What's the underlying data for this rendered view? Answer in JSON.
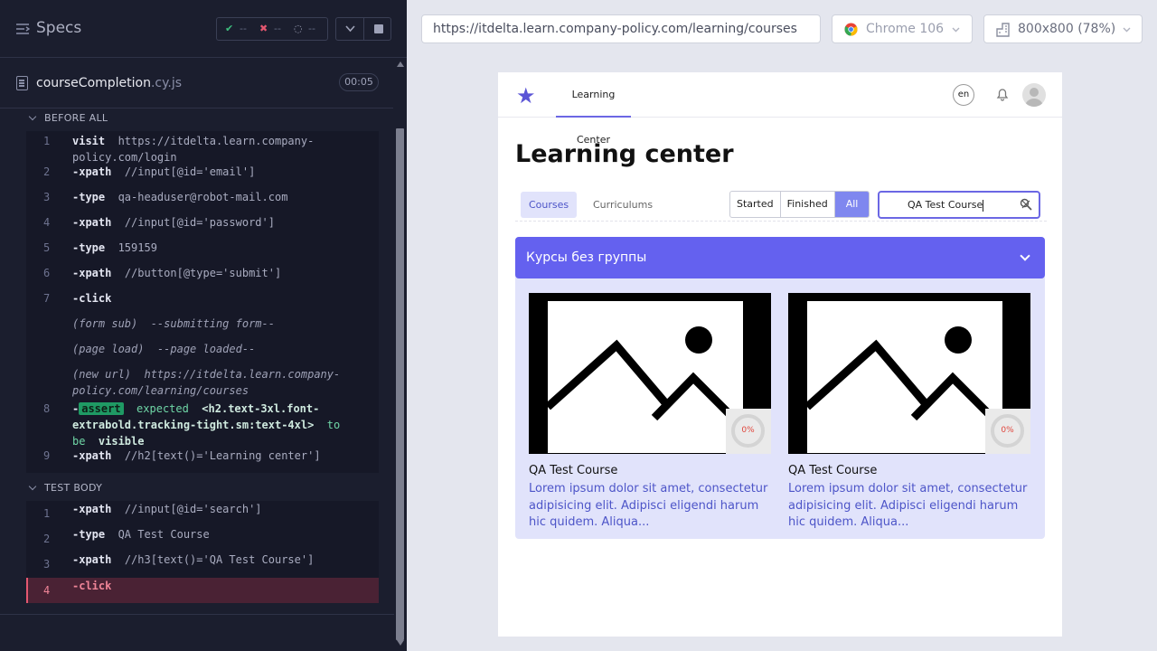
{
  "runner": {
    "title": "Specs",
    "stats": {
      "passed": "--",
      "failed": "--",
      "pending": "--"
    },
    "file": {
      "name": "courseCompletion",
      "ext": ".cy.js",
      "duration": "00:05"
    },
    "before_all": {
      "label": "BEFORE ALL",
      "commands": [
        {
          "num": "1",
          "name": "visit",
          "arg": "https://itdelta.learn.company-policy.com/login"
        },
        {
          "num": "2",
          "name": "-xpath",
          "arg": "//input[@id='email']"
        },
        {
          "num": "3",
          "name": "-type",
          "arg": "qa-headuser@robot-mail.com"
        },
        {
          "num": "4",
          "name": "-xpath",
          "arg": "//input[@id='password']"
        },
        {
          "num": "5",
          "name": "-type",
          "arg": "159159"
        },
        {
          "num": "6",
          "name": "-xpath",
          "arg": "//button[@type='submit']"
        },
        {
          "num": "7",
          "name": "-click",
          "arg": ""
        },
        {
          "event": "(form sub)",
          "text": "--submitting form--"
        },
        {
          "event": "(page load)",
          "text": "--page loaded--"
        },
        {
          "event": "(new url)",
          "text": "https://itdelta.learn.company-policy.com/learning/courses"
        },
        {
          "num": "8",
          "assert_badge": "assert",
          "expected": "expected",
          "selector": "<h2.text-3xl.font-extrabold.tracking-tight.sm:text-4xl>",
          "to_be": "to be",
          "visible": "visible"
        },
        {
          "num": "9",
          "name": "-xpath",
          "arg": "//h2[text()='Learning center']"
        }
      ]
    },
    "test_body": {
      "label": "TEST BODY",
      "commands": [
        {
          "num": "1",
          "name": "-xpath",
          "arg": "//input[@id='search']"
        },
        {
          "num": "2",
          "name": "-type",
          "arg": "QA Test Course"
        },
        {
          "num": "3",
          "name": "-xpath",
          "arg": "//h3[text()='QA Test Course']"
        },
        {
          "num": "4",
          "name": "-click",
          "arg": "",
          "state": "failed"
        }
      ]
    }
  },
  "browser_bar": {
    "url": "https://itdelta.learn.company-policy.com/learning/courses",
    "browser": "Chrome 106",
    "viewport": "800x800",
    "scale": "(78%)"
  },
  "app": {
    "nav_tab": "Learning Center",
    "lang": "en",
    "heading": "Learning center",
    "tabs": [
      "Courses",
      "Curriculums"
    ],
    "filters": [
      "Started",
      "Finished",
      "All"
    ],
    "search_value": "QA Test Course",
    "group_title": "Курсы без группы",
    "cards": [
      {
        "title": "QA Test Course",
        "progress": "0%",
        "desc": "Lorem ipsum dolor sit amet, consectetur adipisicing elit. Adipisci eligendi harum hic quidem. Aliqua..."
      },
      {
        "title": "QA Test Course",
        "progress": "0%",
        "desc": "Lorem ipsum dolor sit amet, consectetur adipisicing elit. Adipisci eligendi harum hic quidem. Aliqua..."
      }
    ]
  },
  "colors": {
    "accent": "#6461ef",
    "passed": "#1f9a64",
    "failed": "#e45770"
  }
}
